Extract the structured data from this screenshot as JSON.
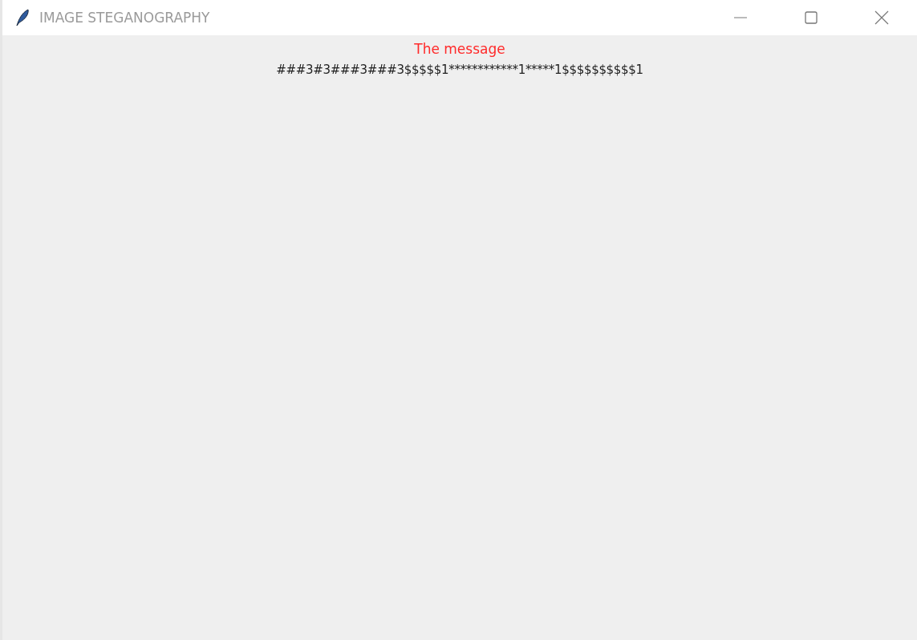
{
  "window": {
    "title": "IMAGE STEGANOGRAPHY"
  },
  "content": {
    "heading": "The message",
    "message": "###3#3###3###3$$$$$1************1*****1$$$$$$$$$$1"
  }
}
